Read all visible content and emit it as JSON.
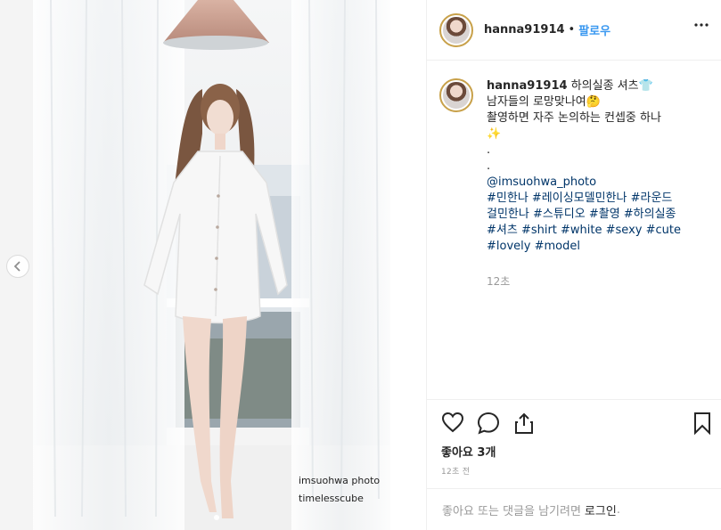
{
  "post": {
    "username": "hanna91914",
    "separator": "•",
    "follow_label": "팔로우",
    "photo_watermark_line1": "imsuohwa photo",
    "photo_watermark_line2": "timelesscube"
  },
  "caption": {
    "username": "hanna91914",
    "line1": "하의실종 셔츠👕",
    "line2": "남자들의 로망맞나여🤔",
    "line3": "촬영하면 자주 논의하는 컨셉중 하나",
    "line4": "✨",
    "dot1": ".",
    "dot2": ".",
    "mention": "@imsuohwa_photo",
    "hashtags_line1": "#민한나 #레이싱모델민한나 #라운드",
    "hashtags_line2": "걸민한나 #스튜디오 #촬영 #하의실종",
    "hashtags_line3": "#셔츠 #shirt #white #sexy #cute",
    "hashtags_line4": "#lovely #model",
    "time": "12초"
  },
  "footer": {
    "likes": "좋아요 3개",
    "posted_ago": "12초 전",
    "login_prompt": "좋아요 또는 댓글을 남기려면",
    "login_link": "로그인",
    "login_end": "."
  },
  "colors": {
    "accent_link": "#3897f0",
    "hashtag": "#003569",
    "muted": "#999999"
  },
  "icons": [
    "chevron-left-icon",
    "more-icon",
    "heart-icon",
    "comment-icon",
    "share-icon",
    "bookmark-icon"
  ]
}
